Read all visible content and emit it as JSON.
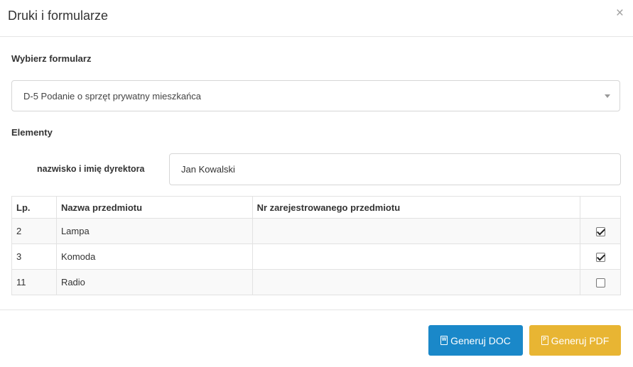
{
  "modal": {
    "title": "Druki i formularze",
    "close_symbol": "×"
  },
  "form_select": {
    "label": "Wybierz formularz",
    "value": "D-5 Podanie o sprzęt prywatny mieszkańca"
  },
  "elements": {
    "label": "Elementy",
    "director_label": "nazwisko i imię dyrektora",
    "director_value": "Jan Kowalski"
  },
  "table": {
    "headers": [
      "Lp.",
      "Nazwa przedmiotu",
      "Nr zarejestrowanego przedmiotu",
      ""
    ],
    "rows": [
      {
        "lp": "2",
        "name": "Lampa",
        "nr": "",
        "checked": true
      },
      {
        "lp": "3",
        "name": "Komoda",
        "nr": "",
        "checked": true
      },
      {
        "lp": "11",
        "name": "Radio",
        "nr": "",
        "checked": false
      }
    ]
  },
  "footer": {
    "doc_label": "Generuj DOC",
    "pdf_label": "Generuj PDF",
    "doc_icon": "file-word-icon",
    "pdf_icon": "file-pdf-icon"
  },
  "colors": {
    "doc_button": "#1a88c9",
    "pdf_button": "#e8b533"
  }
}
